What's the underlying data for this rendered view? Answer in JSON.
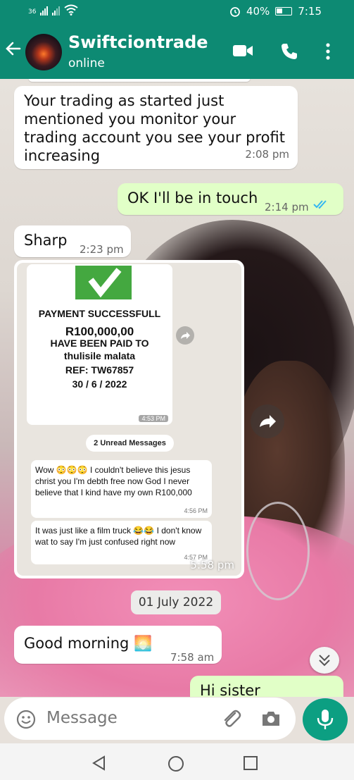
{
  "status_bar": {
    "network_label": "36",
    "battery_percent": "40%",
    "time": "7:15"
  },
  "header": {
    "contact_name": "Swiftciontrade",
    "contact_status": "online",
    "icons": [
      "back-arrow-icon",
      "video-call-icon",
      "voice-call-icon",
      "more-options-icon"
    ]
  },
  "messages": {
    "m1": {
      "text": "Your trading as started just mentioned you monitor your trading account you see your profit increasing",
      "time": "2:08 pm"
    },
    "m2": {
      "text": "OK I'll be in touch",
      "time": "2:14 pm",
      "status": "read"
    },
    "m3": {
      "text": "Sharp",
      "time": "2:23 pm"
    },
    "image_message": {
      "time": "5:58 pm",
      "receipt": {
        "title": "PAYMENT SUCCESSFULL",
        "amount": "R100,000,00",
        "line2": "HAVE BEEN PAID TO",
        "payee": "thulisile malata",
        "ref": "REF: TW67857",
        "date": "30 / 6 / 2022",
        "time": "4:53 PM"
      },
      "unread_chip": "2 Unread Messages",
      "inner1": {
        "text": "Wow 😳😳😳 I couldn't believe this jesus christ you I'm debth free now God I never believe that I kind have my own R100,000",
        "time": "4:56 PM"
      },
      "inner2": {
        "text": "It was just like a film truck 😂😂 I don't know wat to say I'm just confused right now",
        "time": "4:57 PM"
      }
    },
    "date_divider": "01 July 2022",
    "m4": {
      "text": "Good morning 🌅",
      "time": "7:58 am"
    },
    "m5": {
      "text": "Hi sister"
    }
  },
  "input": {
    "placeholder": "Message",
    "icons": [
      "emoji-icon",
      "attach-icon",
      "camera-icon",
      "mic-icon"
    ]
  },
  "colors": {
    "header": "#0d8a73",
    "outgoing_bubble": "#e1ffc7",
    "incoming_bubble": "#ffffff",
    "mic_button": "#0c9f82",
    "read_tick": "#34b7f1"
  }
}
